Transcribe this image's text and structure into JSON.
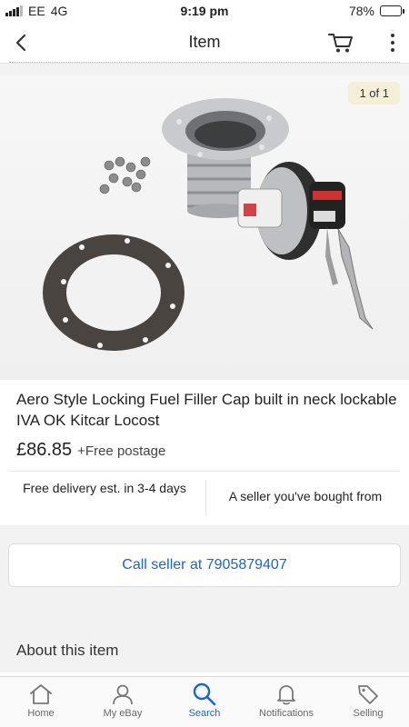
{
  "status_bar": {
    "carrier": "EE",
    "network": "4G",
    "time": "9:19 pm",
    "battery_text": "78%",
    "battery_level": 0.78
  },
  "header": {
    "title": "Item",
    "back_icon": "chevron-left-icon",
    "cart_icon": "cart-icon",
    "more_icon": "more-vertical-icon"
  },
  "gallery": {
    "counter": "1 of 1"
  },
  "item": {
    "title": "Aero Style Locking Fuel Filler Cap built in neck lockable IVA OK Kitcar Locost",
    "price": "£86.85",
    "postage": "+Free postage",
    "delivery": "Free delivery est. in 3-4 days",
    "seller_note": "A seller you've bought from"
  },
  "call_seller": {
    "label": "Call seller at 7905879407"
  },
  "about": {
    "heading": "About this item"
  },
  "tabs": [
    {
      "label": "Home",
      "icon": "home-icon"
    },
    {
      "label": "My eBay",
      "icon": "user-icon"
    },
    {
      "label": "Search",
      "icon": "search-icon",
      "active": true
    },
    {
      "label": "Notifications",
      "icon": "bell-icon"
    },
    {
      "label": "Selling",
      "icon": "tag-icon"
    }
  ],
  "colors": {
    "accent": "#1a66c9",
    "counter_bg": "#f5efd8"
  }
}
